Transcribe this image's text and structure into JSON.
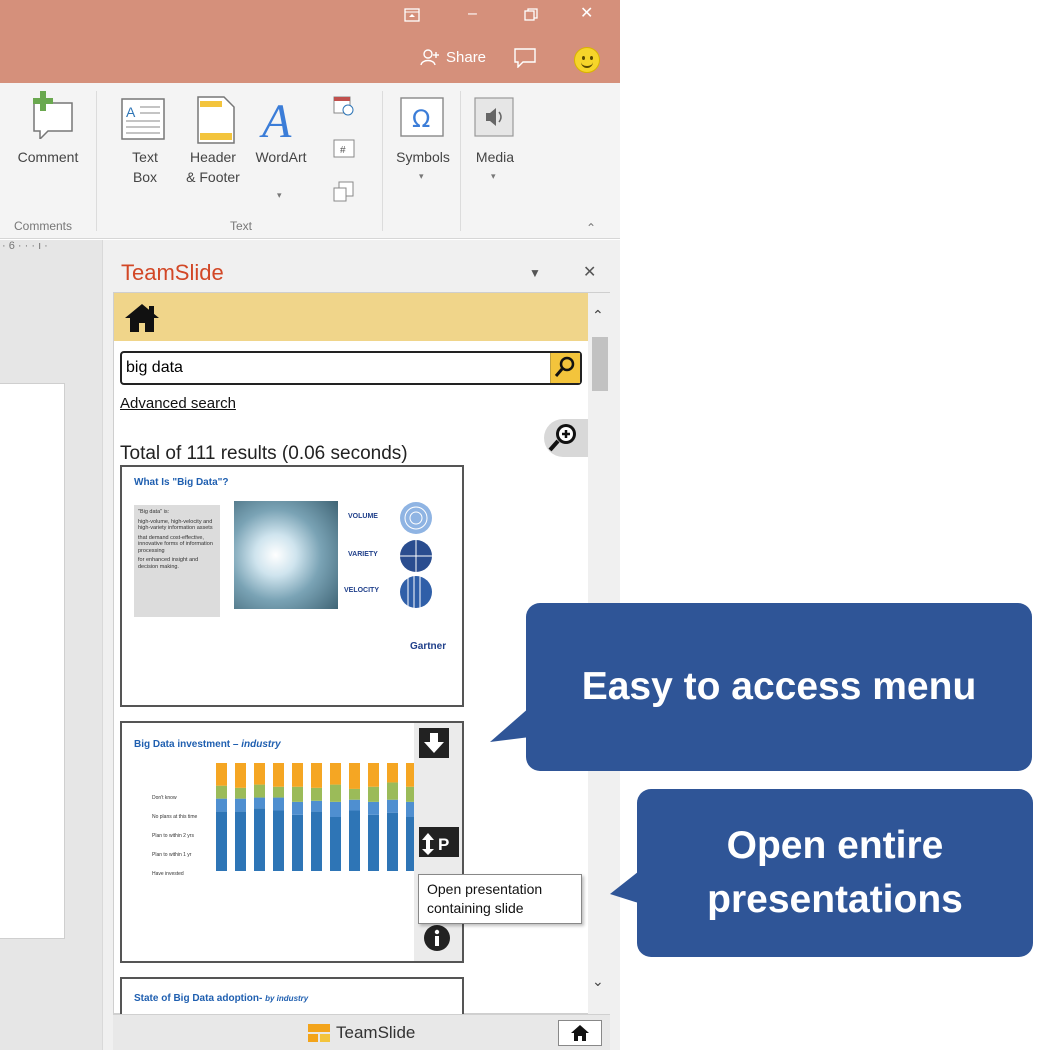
{
  "titlebar": {
    "share_label": "Share"
  },
  "ribbon": {
    "comment_label": "Comment",
    "comments_group": "Comments",
    "textbox_label_1": "Text",
    "textbox_label_2": "Box",
    "header_label_1": "Header",
    "header_label_2": "& Footer",
    "wordart_label": "WordArt",
    "text_group": "Text",
    "symbols_label": "Symbols",
    "media_label": "Media"
  },
  "ruler": {
    "mark": "6"
  },
  "pane": {
    "title": "TeamSlide",
    "search_value": "big data",
    "advanced_search": "Advanced search",
    "results_text": "Total of 111 results (0.06 seconds)",
    "footer_label": "TeamSlide"
  },
  "results": [
    {
      "title": "What Is \"Big Data\"?",
      "bullets_intro": "\"Big data\" is:",
      "bullet_1": "high-volume, high-velocity and high-variety information assets",
      "bullet_2": "that demand cost-effective, innovative forms of information processing",
      "bullet_3": "for enhanced insight and decision making.",
      "volume": "VOLUME",
      "variety": "VARIETY",
      "velocity": "VELOCITY",
      "brand": "Gartner"
    },
    {
      "title": "Big Data investment",
      "title_suffix": "industry",
      "legend_1": "Don't know",
      "legend_2": "No plans at this time",
      "legend_3": "Plan to within 2 yrs",
      "legend_4": "Plan to within 1 yr",
      "legend_5": "Have invested"
    },
    {
      "title": "State of Big Data adoption-",
      "title_suffix": "by industry"
    }
  ],
  "tooltip": {
    "line_1": "Open presentation",
    "line_2": "containing slide"
  },
  "callouts": {
    "menu": "Easy to access menu",
    "open_line_1": "Open entire",
    "open_line_2": "presentations"
  },
  "colors": {
    "titlebar": "#d5907b",
    "pane_title": "#d24726",
    "home_bar": "#f0d58a",
    "callout": "#2f5597",
    "bar_blue": "#2e75b6",
    "bar_green": "#9bbb59",
    "bar_orange": "#f5a623"
  }
}
